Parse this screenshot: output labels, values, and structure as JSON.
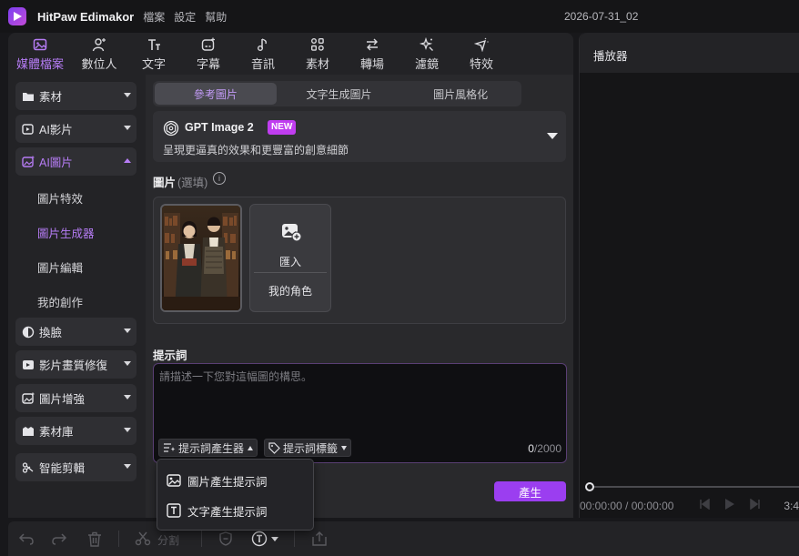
{
  "titlebar": {
    "app_name": "HitPaw Edimakor",
    "menu": [
      "檔案",
      "設定",
      "幫助"
    ],
    "doc_title": "2026-07-31_02"
  },
  "toolbar": {
    "tabs": [
      {
        "label": "媒體檔案",
        "icon": "media-icon",
        "active": true
      },
      {
        "label": "數位人",
        "icon": "avatar-icon",
        "active": false
      },
      {
        "label": "文字",
        "icon": "text-icon",
        "active": false
      },
      {
        "label": "字幕",
        "icon": "subtitle-icon",
        "active": false
      },
      {
        "label": "音訊",
        "icon": "audio-icon",
        "active": false
      },
      {
        "label": "素材",
        "icon": "assets-icon",
        "active": false
      },
      {
        "label": "轉場",
        "icon": "transition-icon",
        "active": false
      },
      {
        "label": "濾鏡",
        "icon": "filter-icon",
        "active": false
      },
      {
        "label": "特效",
        "icon": "effects-icon",
        "active": false
      }
    ]
  },
  "sidebar": {
    "items": [
      {
        "label": "素材",
        "icon": "folder-icon"
      },
      {
        "label": "AI影片",
        "icon": "ai-video-icon"
      },
      {
        "label": "AI圖片",
        "icon": "ai-image-icon",
        "active": true
      },
      {
        "label": "換臉",
        "icon": "face-swap-icon"
      },
      {
        "label": "影片畫質修復",
        "icon": "video-enhance-icon"
      },
      {
        "label": "圖片增強",
        "icon": "image-enhance-icon"
      },
      {
        "label": "素材庫",
        "icon": "library-icon"
      },
      {
        "label": "智能剪輯",
        "icon": "smart-edit-icon"
      }
    ],
    "sub_items": [
      {
        "label": "圖片特效"
      },
      {
        "label": "圖片生成器",
        "active": true
      },
      {
        "label": "圖片編輯"
      },
      {
        "label": "我的創作"
      }
    ]
  },
  "segmented": {
    "tabs": [
      "參考圖片",
      "文字生成圖片",
      "圖片風格化"
    ],
    "active_index": 0
  },
  "model": {
    "name": "GPT Image 2",
    "badge": "NEW",
    "description": "呈現更逼真的效果和更豐富的創意細節"
  },
  "image_section": {
    "label": "圖片",
    "optional": "(選填)",
    "import_label": "匯入",
    "role_label": "我的角色"
  },
  "prompt": {
    "label": "提示詞",
    "placeholder": "請描述一下您對這幅圖的構思。",
    "value": "",
    "generator_label": "提示詞產生器",
    "tags_label": "提示詞標籤",
    "count": "0",
    "max": "/2000"
  },
  "dropdown": {
    "items": [
      {
        "label": "圖片產生提示詞",
        "icon": "image-icon"
      },
      {
        "label": "文字產生提示詞",
        "icon": "text-box-icon"
      }
    ]
  },
  "generate_button": "產生",
  "player": {
    "title": "播放器",
    "timecode": "00:00:00 / 00:00:00",
    "ratio": "3:4"
  },
  "bottombar": {
    "split_label": "分割"
  },
  "colors": {
    "accent": "#b67cf5",
    "primary_button": "#9b3ef0",
    "badge": "#c03df0"
  }
}
